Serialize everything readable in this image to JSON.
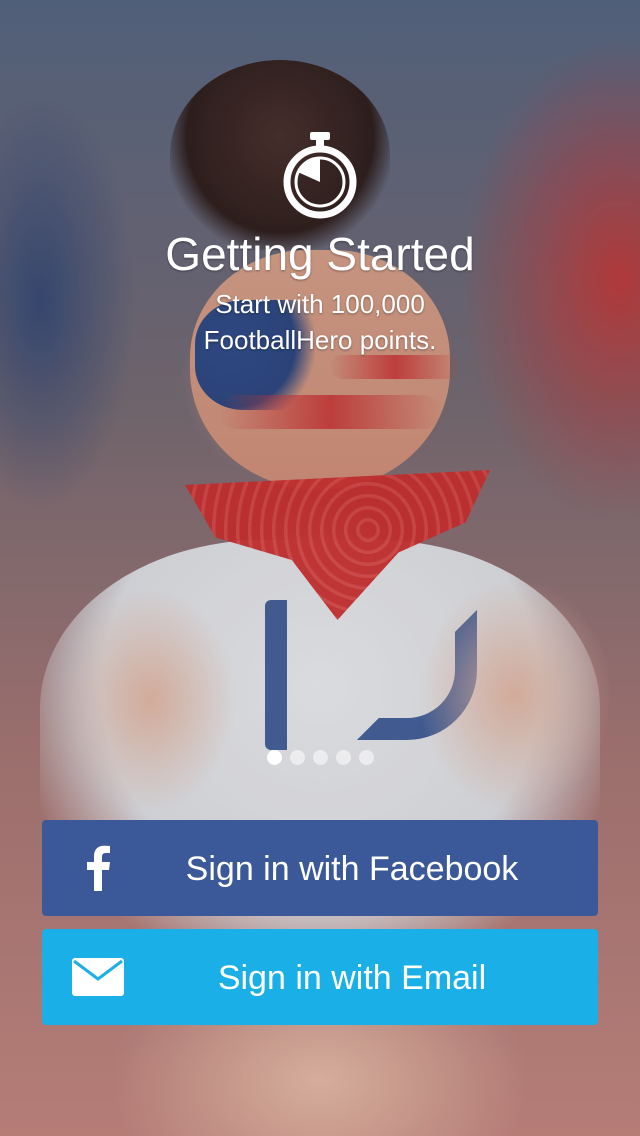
{
  "screen": {
    "title": "Getting Started",
    "subtitle_lines": [
      "Start with 100,000",
      "FootballHero points."
    ]
  },
  "pager": {
    "count": 5,
    "active_index": 0
  },
  "buttons": {
    "facebook_label": "Sign in with Facebook",
    "email_label": "Sign in with Email"
  },
  "icons": {
    "header": "stopwatch-icon",
    "facebook": "facebook-f-icon",
    "email": "envelope-icon"
  },
  "colors": {
    "facebook_blue": "#3b5998",
    "email_blue": "#1aafe6",
    "text": "#ffffff"
  }
}
